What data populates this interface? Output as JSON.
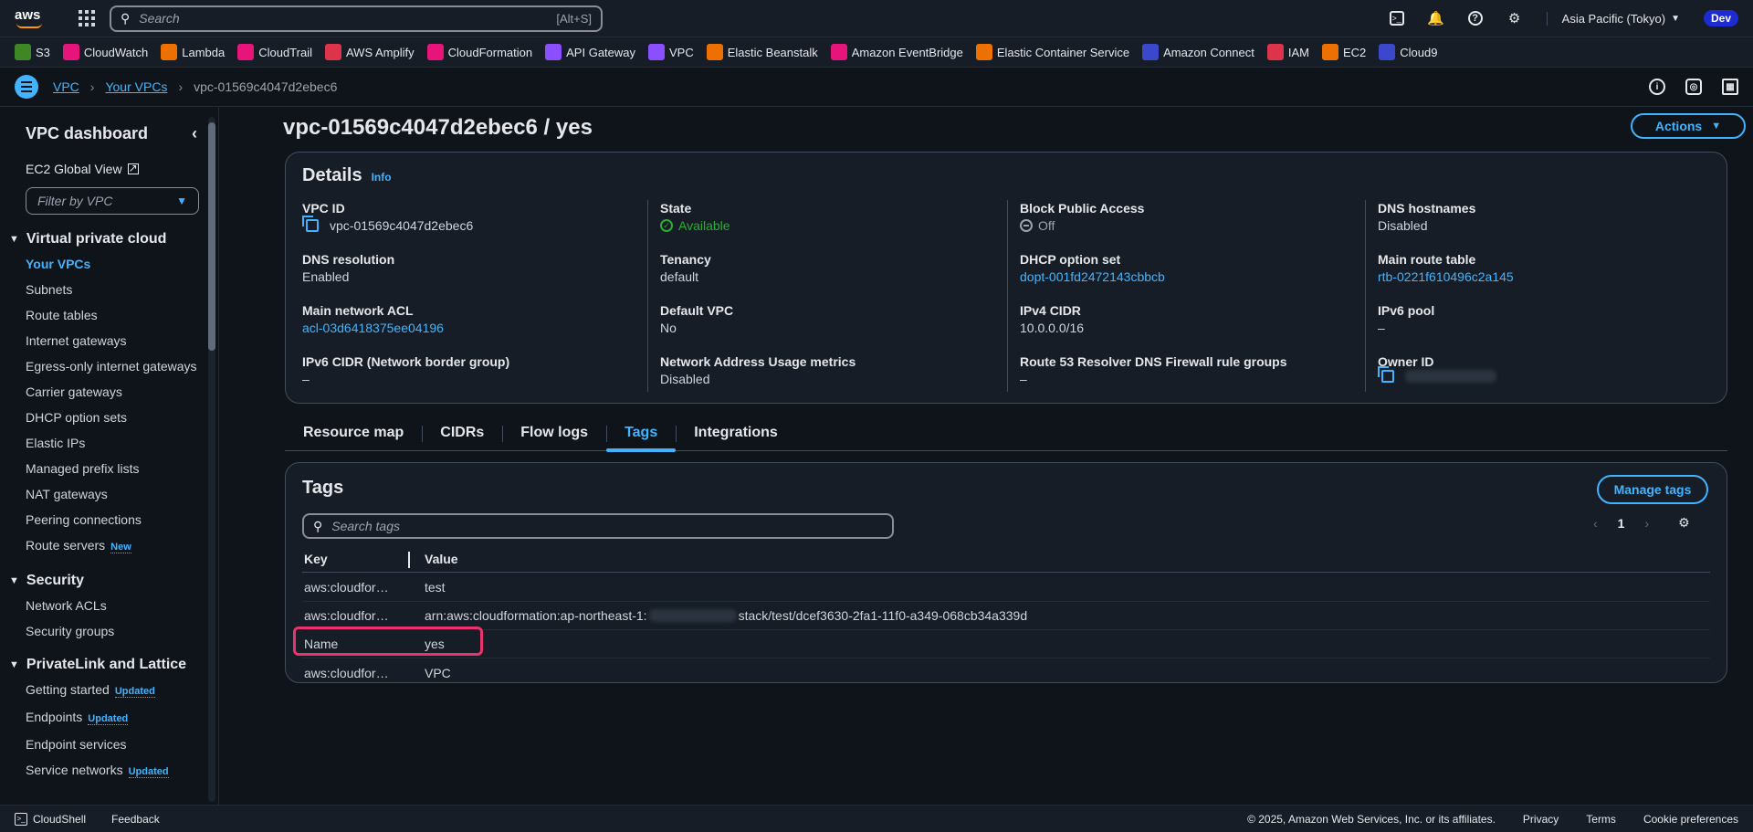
{
  "topnav": {
    "logo": "aws",
    "search_placeholder": "Search",
    "search_shortcut": "[Alt+S]",
    "region": "Asia Pacific (Tokyo)",
    "account_badge": "Dev",
    "icons": [
      "cloudshell-icon",
      "bell-icon",
      "help-icon",
      "gear-icon"
    ]
  },
  "favorites": [
    {
      "label": "S3",
      "color": "#3f8624"
    },
    {
      "label": "CloudWatch",
      "color": "#e7157b"
    },
    {
      "label": "Lambda",
      "color": "#ed7100"
    },
    {
      "label": "CloudTrail",
      "color": "#e7157b"
    },
    {
      "label": "AWS Amplify",
      "color": "#dd344c"
    },
    {
      "label": "CloudFormation",
      "color": "#e7157b"
    },
    {
      "label": "API Gateway",
      "color": "#8c4fff"
    },
    {
      "label": "VPC",
      "color": "#8c4fff"
    },
    {
      "label": "Elastic Beanstalk",
      "color": "#ed7100"
    },
    {
      "label": "Amazon EventBridge",
      "color": "#e7157b"
    },
    {
      "label": "Elastic Container Service",
      "color": "#ed7100"
    },
    {
      "label": "Amazon Connect",
      "color": "#3b48cc"
    },
    {
      "label": "IAM",
      "color": "#dd344c"
    },
    {
      "label": "EC2",
      "color": "#ed7100"
    },
    {
      "label": "Cloud9",
      "color": "#3b48cc"
    }
  ],
  "breadcrumb": {
    "items": [
      "VPC",
      "Your VPCs"
    ],
    "current": "vpc-01569c4047d2ebec6"
  },
  "sidebar": {
    "title": "VPC dashboard",
    "ec2_global_view": "EC2 Global View",
    "filter_placeholder": "Filter by VPC",
    "section_vpc": "Virtual private cloud",
    "vpc_items": [
      "Your VPCs",
      "Subnets",
      "Route tables",
      "Internet gateways",
      "Egress-only internet gateways",
      "Carrier gateways",
      "DHCP option sets",
      "Elastic IPs",
      "Managed prefix lists",
      "NAT gateways",
      "Peering connections",
      "Route servers"
    ],
    "new_badge": "New",
    "section_security": "Security",
    "security_items": [
      "Network ACLs",
      "Security groups"
    ],
    "section_privatelink": "PrivateLink and Lattice",
    "privatelink_items": [
      "Getting started",
      "Endpoints",
      "Endpoint services",
      "Service networks"
    ],
    "updated_badge": "Updated"
  },
  "page": {
    "title": "vpc-01569c4047d2ebec6 / yes",
    "actions_label": "Actions"
  },
  "details": {
    "heading": "Details",
    "info": "Info",
    "fields": {
      "vpc_id": {
        "label": "VPC ID",
        "value": "vpc-01569c4047d2ebec6"
      },
      "dns_resolution": {
        "label": "DNS resolution",
        "value": "Enabled"
      },
      "main_network_acl": {
        "label": "Main network ACL",
        "value": "acl-03d6418375ee04196"
      },
      "ipv6_cidr": {
        "label": "IPv6 CIDR (Network border group)",
        "value": "–"
      },
      "state": {
        "label": "State",
        "value": "Available"
      },
      "tenancy": {
        "label": "Tenancy",
        "value": "default"
      },
      "default_vpc": {
        "label": "Default VPC",
        "value": "No"
      },
      "nau_metrics": {
        "label": "Network Address Usage metrics",
        "value": "Disabled"
      },
      "block_public_access": {
        "label": "Block Public Access",
        "value": "Off"
      },
      "dhcp_option_set": {
        "label": "DHCP option set",
        "value": "dopt-001fd2472143cbbcb"
      },
      "ipv4_cidr": {
        "label": "IPv4 CIDR",
        "value": "10.0.0.0/16"
      },
      "route53_resolver": {
        "label": "Route 53 Resolver DNS Firewall rule groups",
        "value": "–"
      },
      "dns_hostnames": {
        "label": "DNS hostnames",
        "value": "Disabled"
      },
      "main_route_table": {
        "label": "Main route table",
        "value": "rtb-0221f610496c2a145"
      },
      "ipv6_pool": {
        "label": "IPv6 pool",
        "value": "–"
      },
      "owner_id": {
        "label": "Owner ID",
        "value": ""
      }
    }
  },
  "tabs": [
    "Resource map",
    "CIDRs",
    "Flow logs",
    "Tags",
    "Integrations"
  ],
  "active_tab": "Tags",
  "tags": {
    "heading": "Tags",
    "manage_label": "Manage tags",
    "search_placeholder": "Search tags",
    "page": "1",
    "columns": {
      "key": "Key",
      "value": "Value"
    },
    "rows": [
      {
        "key": "aws:cloudfor…",
        "value": "test"
      },
      {
        "key": "aws:cloudfor…",
        "value_prefix": "arn:aws:cloudformation:ap-northeast-1:",
        "value_suffix": "stack/test/dcef3630-2fa1-11f0-a349-068cb34a339d"
      },
      {
        "key": "Name",
        "value": "yes"
      },
      {
        "key": "aws:cloudfor…",
        "value": "VPC"
      }
    ]
  },
  "footer": {
    "cloudshell": "CloudShell",
    "feedback": "Feedback",
    "copyright": "© 2025, Amazon Web Services, Inc. or its affiliates.",
    "privacy": "Privacy",
    "terms": "Terms",
    "cookies": "Cookie preferences"
  }
}
